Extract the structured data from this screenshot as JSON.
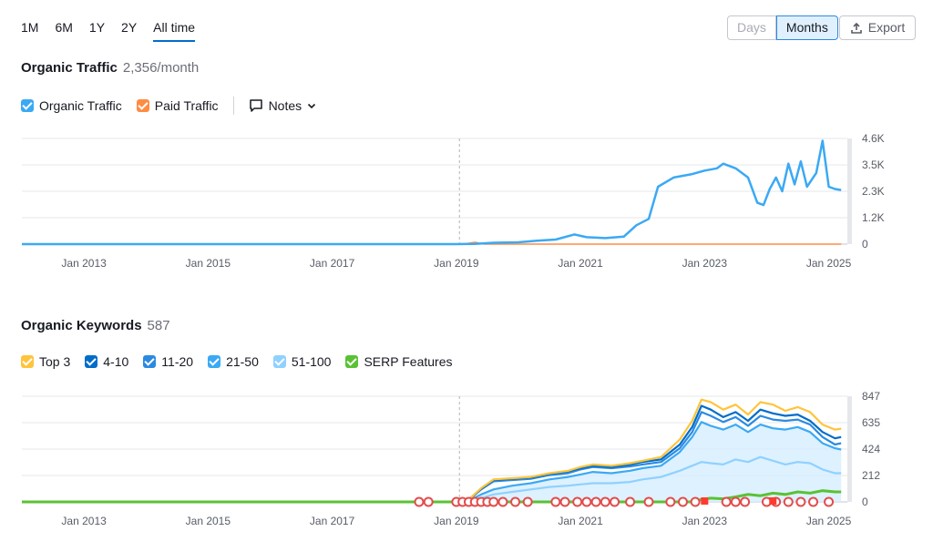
{
  "range_tabs": [
    "1M",
    "6M",
    "1Y",
    "2Y",
    "All time"
  ],
  "active_range": "All time",
  "granularity": {
    "days": "Days",
    "months": "Months",
    "selected": "Months"
  },
  "export_label": "Export",
  "traffic": {
    "title": "Organic Traffic",
    "subtitle": "2,356/month",
    "legend": [
      {
        "label": "Organic Traffic",
        "color": "#3ba9f4"
      },
      {
        "label": "Paid Traffic",
        "color": "#ff8c43"
      }
    ],
    "notes_label": "Notes"
  },
  "keywords": {
    "title": "Organic Keywords",
    "subtitle": "587",
    "legend": [
      {
        "label": "Top 3",
        "color": "#ffc43b"
      },
      {
        "label": "4-10",
        "color": "#006dca"
      },
      {
        "label": "11-20",
        "color": "#2b8ae0"
      },
      {
        "label": "21-50",
        "color": "#3ba9f4"
      },
      {
        "label": "51-100",
        "color": "#8fd1ff"
      },
      {
        "label": "SERP Features",
        "color": "#59c233"
      }
    ]
  },
  "chart_data": [
    {
      "type": "line",
      "title": "Organic Traffic",
      "x_ticks": [
        "Jan 2013",
        "Jan 2015",
        "Jan 2017",
        "Jan 2019",
        "Jan 2021",
        "Jan 2023",
        "Jan 2025"
      ],
      "y_ticks": [
        "4.6K",
        "3.5K",
        "2.3K",
        "1.2K",
        "0"
      ],
      "ylim": [
        0,
        4600
      ],
      "xlim": [
        2012.0,
        2025.3
      ],
      "grid": true,
      "series": [
        {
          "name": "Organic Traffic",
          "color": "#3ba9f4",
          "points": [
            [
              2012.0,
              0
            ],
            [
              2019.0,
              0
            ],
            [
              2019.3,
              10
            ],
            [
              2019.6,
              60
            ],
            [
              2020.0,
              80
            ],
            [
              2020.3,
              150
            ],
            [
              2020.6,
              200
            ],
            [
              2020.9,
              420
            ],
            [
              2021.1,
              300
            ],
            [
              2021.4,
              260
            ],
            [
              2021.7,
              330
            ],
            [
              2021.9,
              820
            ],
            [
              2022.1,
              1100
            ],
            [
              2022.25,
              2500
            ],
            [
              2022.5,
              2900
            ],
            [
              2022.8,
              3050
            ],
            [
              2023.0,
              3200
            ],
            [
              2023.2,
              3300
            ],
            [
              2023.3,
              3500
            ],
            [
              2023.5,
              3300
            ],
            [
              2023.7,
              2900
            ],
            [
              2023.85,
              1800
            ],
            [
              2023.95,
              1700
            ],
            [
              2024.05,
              2400
            ],
            [
              2024.15,
              2900
            ],
            [
              2024.25,
              2300
            ],
            [
              2024.35,
              3500
            ],
            [
              2024.45,
              2600
            ],
            [
              2024.55,
              3600
            ],
            [
              2024.65,
              2500
            ],
            [
              2024.8,
              3100
            ],
            [
              2024.9,
              4500
            ],
            [
              2025.0,
              2500
            ],
            [
              2025.1,
              2400
            ],
            [
              2025.2,
              2356
            ]
          ]
        },
        {
          "name": "Paid Traffic",
          "color": "#ff8c43",
          "points": [
            [
              2012.0,
              0
            ],
            [
              2019.1,
              0
            ],
            [
              2019.3,
              80
            ],
            [
              2019.45,
              0
            ],
            [
              2025.2,
              0
            ]
          ]
        }
      ]
    },
    {
      "type": "area",
      "title": "Organic Keywords",
      "x_ticks": [
        "Jan 2013",
        "Jan 2015",
        "Jan 2017",
        "Jan 2019",
        "Jan 2021",
        "Jan 2023",
        "Jan 2025"
      ],
      "y_ticks": [
        "847",
        "635",
        "424",
        "212",
        "0"
      ],
      "ylim": [
        0,
        847
      ],
      "xlim": [
        2012.0,
        2025.3
      ],
      "grid": true,
      "x": [
        2019.2,
        2019.4,
        2019.6,
        2019.9,
        2020.2,
        2020.5,
        2020.8,
        2021.0,
        2021.2,
        2021.5,
        2021.8,
        2022.0,
        2022.3,
        2022.6,
        2022.8,
        2022.95,
        2023.1,
        2023.3,
        2023.5,
        2023.7,
        2023.9,
        2024.1,
        2024.3,
        2024.5,
        2024.7,
        2024.9,
        2025.1,
        2025.2
      ],
      "series": [
        {
          "name": "Top 3",
          "color": "#ffc43b",
          "values": [
            20,
            110,
            180,
            190,
            200,
            230,
            250,
            280,
            300,
            290,
            310,
            330,
            360,
            500,
            650,
            820,
            800,
            740,
            780,
            700,
            800,
            780,
            730,
            760,
            720,
            620,
            580,
            587
          ]
        },
        {
          "name": "4-10",
          "color": "#006dca",
          "values": [
            20,
            105,
            175,
            185,
            195,
            225,
            245,
            270,
            290,
            280,
            300,
            320,
            340,
            460,
            600,
            770,
            740,
            680,
            720,
            650,
            740,
            710,
            690,
            700,
            650,
            560,
            510,
            520
          ]
        },
        {
          "name": "11-20",
          "color": "#2b8ae0",
          "values": [
            15,
            100,
            165,
            175,
            185,
            215,
            230,
            260,
            280,
            270,
            285,
            300,
            320,
            430,
            560,
            720,
            690,
            640,
            680,
            610,
            690,
            660,
            650,
            660,
            620,
            520,
            460,
            470
          ]
        },
        {
          "name": "21-50",
          "color": "#3ba9f4",
          "values": [
            10,
            60,
            100,
            130,
            150,
            180,
            200,
            220,
            240,
            230,
            250,
            270,
            290,
            400,
            520,
            640,
            610,
            580,
            620,
            560,
            620,
            590,
            580,
            600,
            560,
            470,
            430,
            420
          ]
        },
        {
          "name": "51-100",
          "color": "#8fd1ff",
          "values": [
            5,
            30,
            60,
            80,
            100,
            120,
            130,
            140,
            150,
            150,
            160,
            180,
            200,
            250,
            290,
            320,
            310,
            300,
            340,
            320,
            360,
            330,
            300,
            320,
            310,
            260,
            230,
            230
          ]
        },
        {
          "name": "SERP Features",
          "color": "#59c233",
          "values": [
            0,
            0,
            0,
            0,
            0,
            0,
            0,
            0,
            0,
            0,
            0,
            0,
            0,
            0,
            0,
            20,
            30,
            25,
            40,
            60,
            50,
            70,
            60,
            80,
            70,
            90,
            80,
            80
          ]
        }
      ]
    }
  ]
}
